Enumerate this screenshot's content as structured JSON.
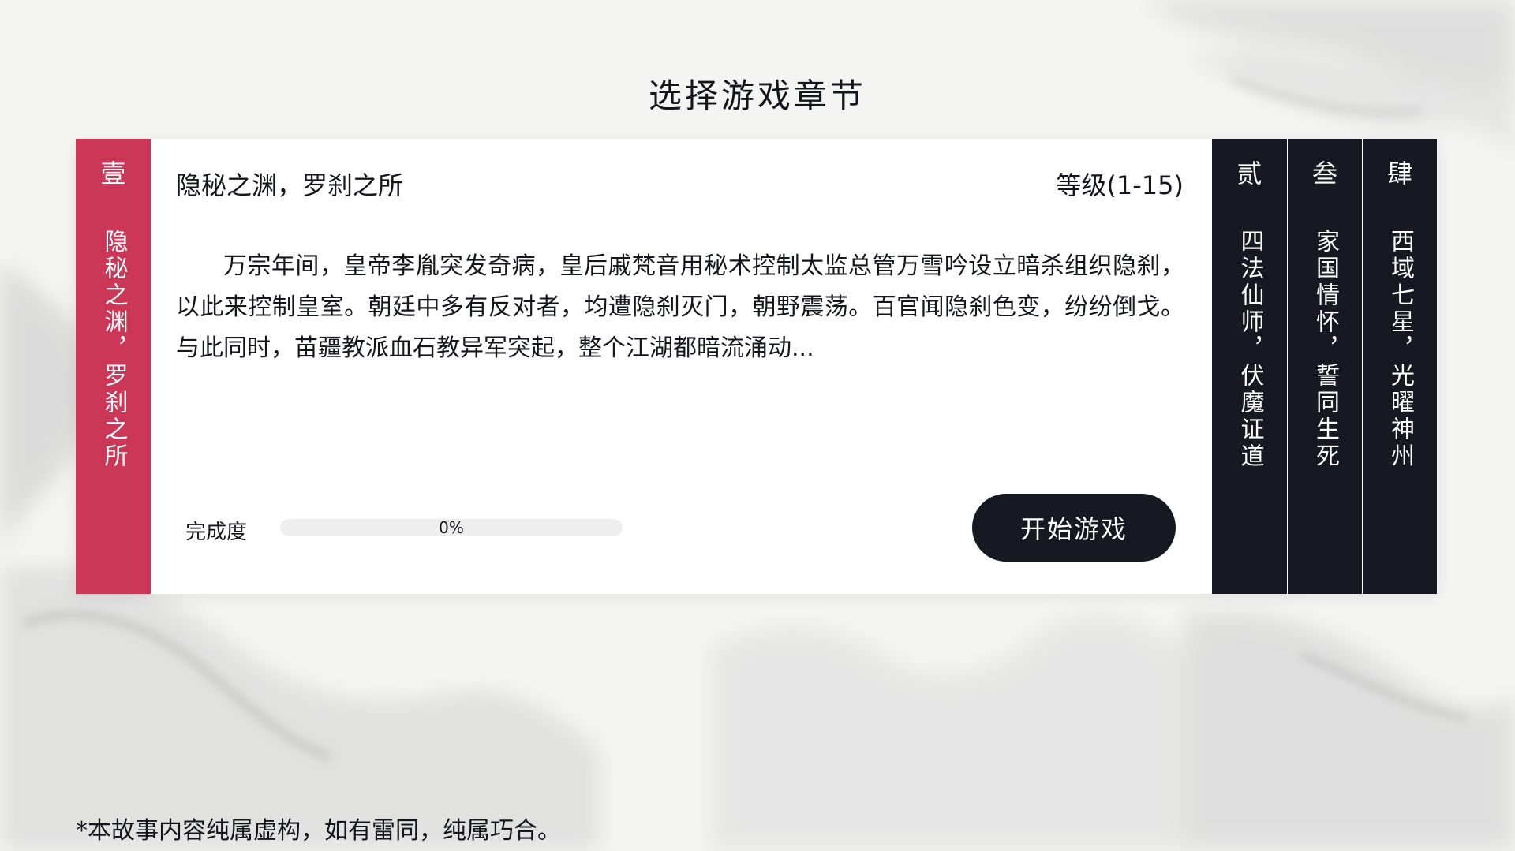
{
  "page": {
    "title": "选择游戏章节",
    "disclaimer": "*本故事内容纯属虚构，如有雷同，纯属巧合。"
  },
  "chapters": [
    {
      "num": "壹",
      "name": "隐秘之渊，罗刹之所",
      "active": true
    },
    {
      "num": "贰",
      "name": "四法仙师，伏魔证道",
      "active": false
    },
    {
      "num": "叁",
      "name": "家国情怀，誓同生死",
      "active": false
    },
    {
      "num": "肆",
      "name": "西域七星，光曜神州",
      "active": false
    }
  ],
  "selected": {
    "title": "隐秘之渊，罗刹之所",
    "level": "等级(1-15)",
    "description": "万宗年间，皇帝李胤突发奇病，皇后戚梵音用秘术控制太监总管万雪吟设立暗杀组织隐刹，以此来控制皇室。朝廷中多有反对者，均遭隐刹灭门，朝野震荡。百官闻隐刹色变，纷纷倒戈。与此同时，苗疆教派血石教异军突起，整个江湖都暗流涌动...",
    "progress_label": "完成度",
    "progress_value": 0,
    "progress_text": "0%",
    "start_label": "开始游戏"
  },
  "colors": {
    "accent": "#cc3657",
    "dark": "#171922",
    "text": "#15161d"
  }
}
